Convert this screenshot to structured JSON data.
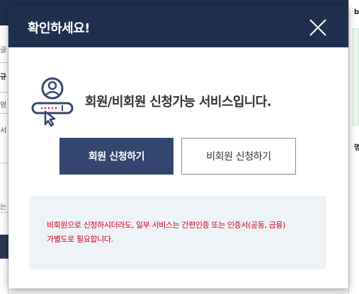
{
  "background": {
    "left_fragments": [
      "글",
      "규",
      "영",
      "서",
      "는"
    ],
    "right_fragments": [
      "b",
      "명"
    ]
  },
  "modal": {
    "title": "확인하세요!",
    "info_text": "회원/비회원 신청가능 서비스입니다.",
    "buttons": {
      "member": "회원 신청하기",
      "guest": "비회원 신청하기"
    },
    "notice_lines": [
      "비회원으로 신청하시더라도, 일부 서비스는 간편인증 또는 인증서(공동, 금융)",
      "가별도로 필요합니다."
    ]
  },
  "colors": {
    "header": "#1f2f4d",
    "primary_button": "#34466f",
    "notice_background": "#eef3f8",
    "notice_text": "#d0021b"
  },
  "icons": {
    "close": "close-icon",
    "user": "user-sign-up-icon"
  }
}
